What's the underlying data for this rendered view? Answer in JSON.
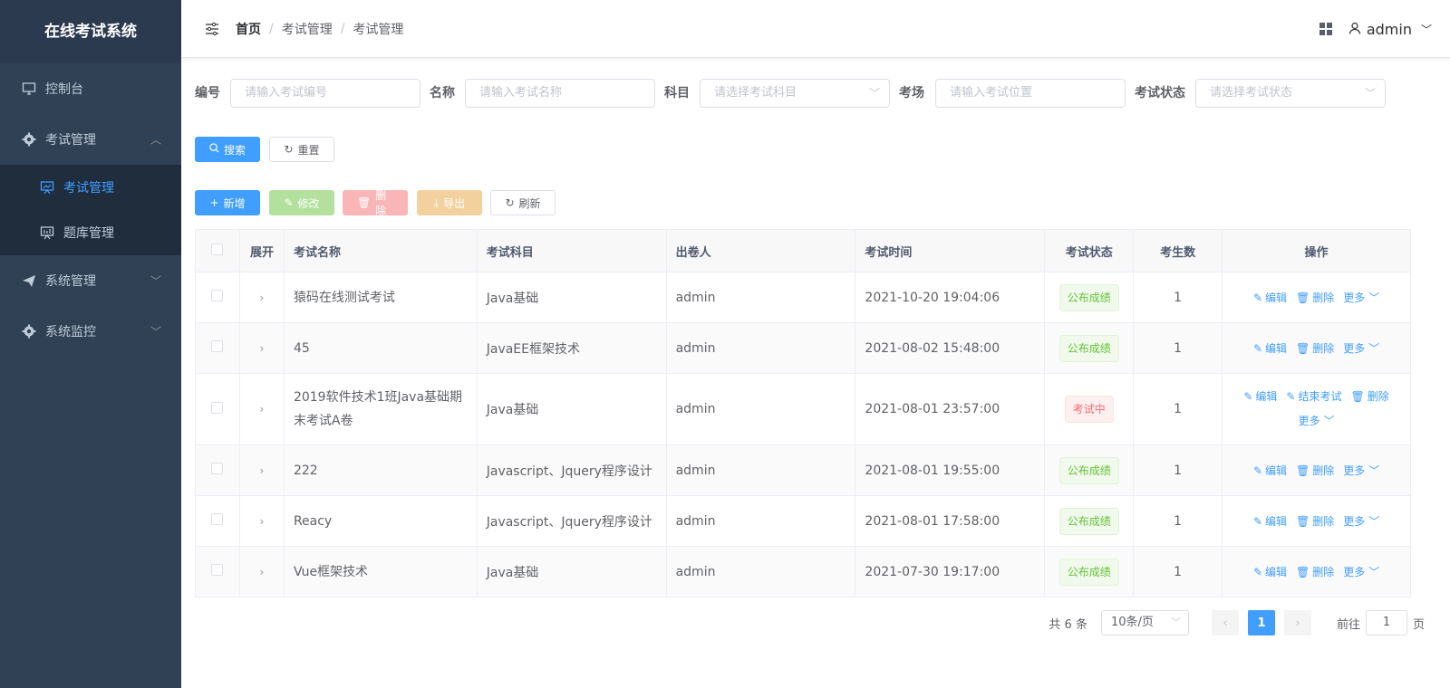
{
  "sidebar": {
    "brand": "在线考试系统",
    "items": [
      {
        "label": "控制台",
        "icon": "monitor-icon"
      },
      {
        "label": "考试管理",
        "icon": "gear-icon",
        "expanded": true,
        "children": [
          {
            "label": "考试管理",
            "icon": "presentation-icon",
            "active": true
          },
          {
            "label": "题库管理",
            "icon": "presentation-icon",
            "active": false
          }
        ]
      },
      {
        "label": "系统管理",
        "icon": "send-icon"
      },
      {
        "label": "系统监控",
        "icon": "gear-icon"
      }
    ]
  },
  "header": {
    "breadcrumb": [
      "首页",
      "考试管理",
      "考试管理"
    ],
    "user": "admin"
  },
  "filters": {
    "code_label": "编号",
    "code_placeholder": "请输入考试编号",
    "name_label": "名称",
    "name_placeholder": "请输入考试名称",
    "subject_label": "科目",
    "subject_placeholder": "请选择考试科目",
    "room_label": "考场",
    "room_placeholder": "请输入考试位置",
    "status_label": "考试状态",
    "status_placeholder": "请选择考试状态",
    "search": "搜索",
    "reset": "重置"
  },
  "toolbar": {
    "add": "新增",
    "edit": "修改",
    "delete": "删除",
    "export": "导出",
    "refresh": "刷新"
  },
  "table": {
    "headers": [
      "展开",
      "考试名称",
      "考试科目",
      "出卷人",
      "考试时间",
      "考试状态",
      "考生数",
      "操作"
    ],
    "rows": [
      {
        "name": "猿码在线测试考试",
        "subject": "Java基础",
        "author": "admin",
        "time": "2021-10-20 19:04:06",
        "status": "公布成绩",
        "status_type": "success",
        "count": "1"
      },
      {
        "name": "45",
        "subject": "JavaEE框架技术",
        "author": "admin",
        "time": "2021-08-02 15:48:00",
        "status": "公布成绩",
        "status_type": "success",
        "count": "1"
      },
      {
        "name": "2019软件技术1班Java基础期末考试A卷",
        "subject": "Java基础",
        "author": "admin",
        "time": "2021-08-01 23:57:00",
        "status": "考试中",
        "status_type": "danger",
        "count": "1"
      },
      {
        "name": "222",
        "subject": "Javascript、Jquery程序设计",
        "author": "admin",
        "time": "2021-08-01 19:55:00",
        "status": "公布成绩",
        "status_type": "success",
        "count": "1"
      },
      {
        "name": "Reacy",
        "subject": "Javascript、Jquery程序设计",
        "author": "admin",
        "time": "2021-08-01 17:58:00",
        "status": "公布成绩",
        "status_type": "success",
        "count": "1"
      },
      {
        "name": "Vue框架技术",
        "subject": "Java基础",
        "author": "admin",
        "time": "2021-07-30 19:17:00",
        "status": "公布成绩",
        "status_type": "success",
        "count": "1"
      }
    ],
    "actions": {
      "edit": "编辑",
      "delete": "删除",
      "more": "更多",
      "end": "结束考试"
    }
  },
  "pagination": {
    "total": "共 6 条",
    "page_size": "10条/页",
    "current_page": "1",
    "goto_label": "前往",
    "goto_value": "1",
    "page_suffix": "页"
  },
  "colors": {
    "primary": "#409EFF",
    "sidebar_bg": "#304156",
    "success": "#67c23a",
    "danger": "#f56c6c"
  }
}
